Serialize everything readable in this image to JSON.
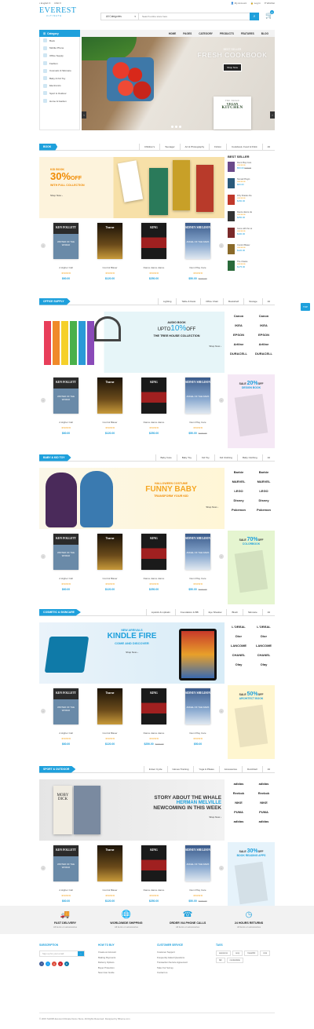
{
  "topbar": {
    "language": "English",
    "currency": "USD",
    "my_account": "My Account",
    "login": "Log In",
    "wishlist": "Wishlist"
  },
  "logo": {
    "title": "EVEREST",
    "subtitle": "ULTIMATE"
  },
  "search": {
    "category": "All Categories",
    "placeholder": "Search entire store here"
  },
  "cart": {
    "count": "0"
  },
  "nav": {
    "category_label": "Category",
    "items": [
      "HOME",
      "PAGES",
      "CATEGORY",
      "PRODUCTS",
      "FEATURES",
      "BLOG"
    ]
  },
  "sidebar": {
    "items": [
      "Book",
      "Mobile Phone",
      "Office Supply",
      "Fashion",
      "Cosmetic & Skincare",
      "Baby & Kid Toy",
      "Electronics",
      "Sport & Outdoor",
      "Home & Garden"
    ]
  },
  "hero": {
    "subtitle": "BEST SELLER",
    "title": "FRESH COOKBOOK",
    "button": "Shop Now",
    "book_line1": "THE FRESH",
    "book_line2": "VEGAN",
    "book_line3": "KITCHEN"
  },
  "sections": [
    {
      "title": "BOOK",
      "tabs": [
        "Children's",
        "Teenager",
        "Art & Photography",
        "Fiction",
        "Cookbook, Food & Drink",
        "All"
      ],
      "banner": {
        "kicker": "KID BOOK",
        "big": "30%",
        "off": "OFF",
        "line": "WITH FULL COLLECTION",
        "button": "Shop Now"
      }
    },
    {
      "title": "OFFICE SUPPLY",
      "tabs": [
        "Lighting",
        "Table & Desk",
        "Office Chair",
        "Bookshelf",
        "Storage",
        "All"
      ],
      "banner": {
        "kicker": "AUDIO BOOK",
        "pre": "UPTO",
        "big": "10%",
        "off": "OFF",
        "line": "THE TREE HOUSE COLLECTION",
        "button": "Shop Now"
      }
    },
    {
      "title": "BABY & KID TOY",
      "tabs": [
        "Baby Care",
        "Baby Toy",
        "Kid Toy",
        "Kid Clothing",
        "Baby Clothing",
        "All"
      ],
      "banner": {
        "kicker": "HALLOWEEN COSTUME",
        "big": "FUNNY BABY",
        "line": "TRANSFORM YOUR KID",
        "button": "Shop Now"
      }
    },
    {
      "title": "COSMETIC & SKINCARE",
      "tabs": [
        "Lipstick & Lipbalm",
        "Foundation & BB",
        "Eye Shadow",
        "Blush",
        "Skincare",
        "All"
      ],
      "banner": {
        "kicker": "NEW ARRIVALS",
        "big": "KINDLE FIRE",
        "line": "COME AND DISCOVER",
        "button": "Shop Now"
      }
    },
    {
      "title": "SPORT & OUTDOOR",
      "tabs": [
        "Indoor Cycle",
        "Gloves Training",
        "Yoga & Pilates",
        "Accessories",
        "Dumbbell",
        "All"
      ],
      "banner": {
        "kicker": "",
        "big": "STORY ABOUT THE WHALE",
        "line": "HERMAN MELVILLE",
        "line2": "NEWCOMING IN THIS WEEK",
        "button": "Shop Now",
        "book_title": "MOBY DICK"
      }
    }
  ],
  "products": [
    {
      "name": "A Higher Call",
      "stars": "★★★★★",
      "price": "$60.00",
      "old": "",
      "cover_title": "KEN FOLLETT",
      "cover_sub": "WINTER OF THE WORLD"
    },
    {
      "name": "Control Blaser",
      "stars": "★★★★★",
      "price": "$120.00",
      "old": "",
      "cover_title": "Tearne",
      "cover_sub": ""
    },
    {
      "name": "Dance dance dance",
      "stars": "★★★★★",
      "price": "$250.00",
      "old": "",
      "cover_title": "KING",
      "cover_sub": ""
    },
    {
      "name": "Demi Play Care",
      "stars": "★★★★★",
      "price": "$50.00",
      "old": "$100.00",
      "cover_title": "SIDNEY SHELDON",
      "cover_sub": "ANGEL OF THE DARK"
    }
  ],
  "products_sec4": [
    {
      "name": "A Higher Call",
      "stars": "★★★★★",
      "price": "$60.00",
      "old": "",
      "cover_title": "KEN FOLLETT",
      "cover_sub": "WINTER OF THE WORLD"
    },
    {
      "name": "Control Blaser",
      "stars": "★★★★★",
      "price": "$120.00",
      "old": "",
      "cover_title": "Tearne",
      "cover_sub": ""
    },
    {
      "name": "Dance dance dance",
      "stars": "★★★★★",
      "price": "$250.00",
      "old": "$100.00",
      "cover_title": "KING",
      "cover_sub": ""
    },
    {
      "name": "Demi Play Care",
      "stars": "★★★★★",
      "price": "$50.00",
      "old": "",
      "cover_title": "SIDNEY SHELDON",
      "cover_sub": "ANGEL OF THE DARK"
    }
  ],
  "bestseller": {
    "title": "BEST SELLER",
    "items": [
      {
        "name": "Demi Play Care",
        "stars": "★★★★★",
        "price": "$50.00",
        "old": "$100.00"
      },
      {
        "name": "Nomad Plugin",
        "stars": "★★★★★",
        "price": "$60.00"
      },
      {
        "name": "Fifty Shades Da",
        "stars": "★★★★★",
        "price": "$150.00"
      },
      {
        "name": "Dance dance da",
        "stars": "★★★★★",
        "price": "$250.00"
      },
      {
        "name": "Gone with the wi",
        "stars": "★★★★★",
        "price": "$100.00"
      },
      {
        "name": "Control Blaser",
        "stars": "★★★★★",
        "price": "$120.00"
      },
      {
        "name": "The Chaste",
        "stars": "★★★★★",
        "price": "$175.00"
      }
    ]
  },
  "brands_office": [
    "Canon",
    "Canon",
    "IKEA",
    "IKEA",
    "EPSON",
    "EPSON",
    "Artline",
    "Artline",
    "DURACELL",
    "DURACELL"
  ],
  "brands_baby": [
    "Barbie",
    "Barbie",
    "MARVEL",
    "MARVEL",
    "LEGO",
    "LEGO",
    "Disney",
    "Disney",
    "Pokemon",
    "Pokemon"
  ],
  "brands_cosmetic": [
    "L'OREAL",
    "L'OREAL",
    "Dior",
    "Dior",
    "LANCOME",
    "LANCOME",
    "CHANEL",
    "CHANEL",
    "Olay",
    "Olay"
  ],
  "brands_sport": [
    "adidas",
    "adidas",
    "Reebok",
    "Reebok",
    "NIKE",
    "NIKE",
    "PUMA",
    "PUMA",
    "adidas",
    "adidas"
  ],
  "promos": [
    {
      "kicker": "SALE",
      "big": "20%",
      "off": "OFF",
      "line": "DESIGN BOOK"
    },
    {
      "kicker": "SALE",
      "big": "70%",
      "off": "OFF",
      "line": "COLORBOOK"
    },
    {
      "kicker": "SALE",
      "big": "50%",
      "off": "OFF",
      "line": "ARCHITECT BOOK"
    },
    {
      "kicker": "SALE",
      "big": "30%",
      "off": "OFF",
      "line": "BOOK READING APPS"
    }
  ],
  "services": [
    {
      "title": "FAST DELIVERY",
      "desc": "All items on accessories"
    },
    {
      "title": "WORLDWIDE SHIPPING",
      "desc": "All items on accessories"
    },
    {
      "title": "ORDER VIA PHONE CALLS",
      "desc": "All items on accessories"
    },
    {
      "title": "24 HOURS RETURNS",
      "desc": "All items on accessories"
    }
  ],
  "footer": {
    "subscription": "SUBSCRIPTION",
    "sub_placeholder": "Sign up for your email",
    "howto": "HOW TO BUY",
    "howto_links": [
      "Create an Account",
      "Making Payments",
      "Delivery Options",
      "Buyer Protection",
      "New User Guide"
    ],
    "cs": "CUSTOMER SERVICE",
    "cs_links": [
      "Customer Support",
      "Frequently Asked Questions",
      "Transaction Service Agreement",
      "Take Our Survey",
      "Contact us"
    ],
    "tags": "TAGS",
    "tag_items": [
      "awesome",
      "sexy",
      "beautiful",
      "cute",
      "fab",
      "nonlandsite"
    ],
    "copyright": "© 2015 SHOPA Everest Ultimate Demo Store. All Rights Reserved. Designed by 8theme.com"
  },
  "float": {
    "label": "TOP"
  }
}
